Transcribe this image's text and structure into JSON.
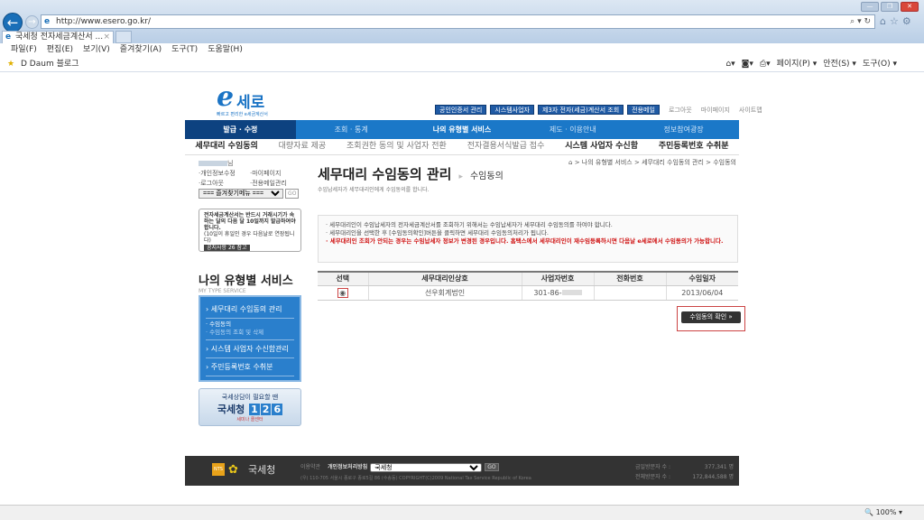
{
  "browser": {
    "url": "http://www.esero.go.kr/",
    "tab_title": "국세청 전자세금계산서 ...",
    "menu": [
      "파일(F)",
      "편집(E)",
      "보기(V)",
      "즐겨찾기(A)",
      "도구(T)",
      "도움말(H)"
    ],
    "favorite": "Daum 블로그",
    "commands": [
      "페이지(P) ▾",
      "안전(S) ▾",
      "도구(O) ▾"
    ],
    "zoom": "100%"
  },
  "header": {
    "logo": "세로",
    "logo_sub": "빠르고 편리한 e세금계산서",
    "util_buttons": [
      "공인인증서 관리",
      "시스템사업자",
      "제3자 전자(세금)계산서 조회",
      "전용메일"
    ],
    "util_links": [
      "로그아웃",
      "마이페이지",
      "사이트맵"
    ]
  },
  "gnb": [
    "발급 · 수정",
    "조회 · 통계",
    "나의 유형별 서비스",
    "제도 · 이용안내",
    "정보참여광장"
  ],
  "lnb": [
    "세무대리 수임동의",
    "대량자료 제공",
    "조회권한 동의 및 사업자 전환",
    "전자결용서식발급 접수",
    "시스템 사업자 수신함",
    "주민등록번호 수취분"
  ],
  "login": {
    "name_suffix": "님",
    "links": [
      "·개인정보수정",
      "·마이페이지",
      "·로그아웃",
      "·전용메일관리"
    ],
    "fav_select": "=== 즐겨찾기메뉴 ===",
    "go": "GO"
  },
  "notice": {
    "text": "전자세금계산서는 반드시 거래시기가 속하는 달의 다음 달 10일까지 발급하여야 합니다.",
    "sub": "(10일이 휴일인 경우 다음날로 연장됩니다)",
    "tag": "공지사항 26 참고"
  },
  "side": {
    "title": "나의 유형별 서비스",
    "title_en": "MY TYPE SERVICE",
    "menu1": "세무대리 수임동의 관리",
    "sub1": "· 수임동의",
    "sub2": "· 수임동의 조회 및 삭제",
    "menu2": "시스템 사업자 수신함관리",
    "menu3": "주민등록번호 수취분",
    "banner_top": "국세상담이 필요할 땐",
    "banner_name": "국세청",
    "banner_num": [
      "1",
      "2",
      "6"
    ],
    "banner_bottom": "세미나 콜센터"
  },
  "main": {
    "title": "세무대리 수임동의 관리",
    "subtitle": "수임동의",
    "desc": "수임납세자가 세무대리인에게 수임동의를 합니다.",
    "breadcrumb": "> 나의 유형별 서비스 > 세무대리 수임동의 관리 > 수임동의",
    "info": [
      "· 세무대리인이 수임납세자의 전자세금계산서를 조회하기 위해서는 수임납세자가 세무대리 수임동의를 하여야 합니다.",
      "· 세무대리인을 선택한 후 [수임동의확인]버튼을 클릭하면 세무대리 수임동의처리가 됩니다.",
      "· 세무대리인 조회가 안되는 경우는 수임납세자 정보가 변경된 경우입니다. 홈택스에서 세무대리인이 재수임등록하시면 다음날 e세로에서 수임동의가 가능합니다."
    ],
    "table": {
      "headers": [
        "선택",
        "세무대리인상호",
        "사업자번호",
        "전화번호",
        "수임일자"
      ],
      "rows": [
        {
          "name": "선우회계법인",
          "bizno": "301-86-",
          "phone": "",
          "date": "2013/06/04"
        }
      ]
    },
    "confirm": "수임동의 확인 »"
  },
  "footer": {
    "brand": "국세청",
    "nts": "NTS",
    "terms": "이용약관",
    "privacy": "개인정보처리방침",
    "select": "국세청",
    "go": "GO",
    "address": "(우) 110-705 서울시 종로구 종로5길 86 (수송동)  COPYRIGHT(C)2009 National Tax Service Republic of Korea",
    "today_label": "금일방문자 수 :",
    "today": "377,341 명",
    "total_label": "전체방문자 수 :",
    "total": "172,844,588 명"
  }
}
